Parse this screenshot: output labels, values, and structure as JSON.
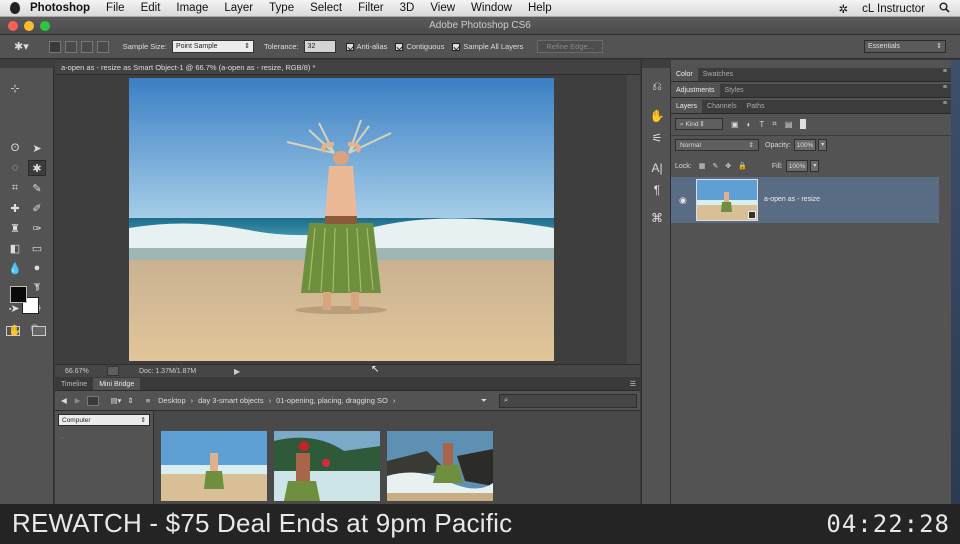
{
  "menubar": {
    "app": "Photoshop",
    "items": [
      "File",
      "Edit",
      "Image",
      "Layer",
      "Type",
      "Select",
      "Filter",
      "3D",
      "View",
      "Window",
      "Help"
    ],
    "user": "cL Instructor"
  },
  "window": {
    "title": "Adobe Photoshop CS6"
  },
  "options_bar": {
    "sample_size_label": "Sample Size:",
    "sample_size_value": "Point Sample",
    "tolerance_label": "Tolerance:",
    "tolerance_value": "32",
    "anti_alias": "Anti-alias",
    "contiguous": "Contiguous",
    "sample_all_layers": "Sample All Layers",
    "refine_edge": "Refine Edge...",
    "workspace": "Essentials"
  },
  "document": {
    "tab_title": "a-open as - resize as Smart Object-1 @ 66.7% (a-open as - resize, RGB/8) *",
    "zoom": "66.67%",
    "doc_info": "Doc: 1.37M/1.87M"
  },
  "bridge": {
    "tabs": [
      "Timeline",
      "Mini Bridge"
    ],
    "breadcrumb": [
      "Desktop",
      "day 3-smart objects",
      "01-opening, placing, dragging SO"
    ],
    "location": "Computer"
  },
  "panels": {
    "group1_tabs": [
      "Color",
      "Swatches"
    ],
    "group2_tabs": [
      "Adjustments",
      "Styles"
    ],
    "group3_tabs": [
      "Layers",
      "Channels",
      "Paths"
    ],
    "kind_filter": "Kind",
    "blend_mode": "Normal",
    "opacity_label": "Opacity:",
    "opacity_value": "100%",
    "lock_label": "Lock:",
    "fill_label": "Fill:",
    "fill_value": "100%",
    "layer_name": "a-open as - resize"
  },
  "banner": {
    "text": "REWATCH - $75 Deal Ends at 9pm Pacific",
    "timer": "04:22:28"
  }
}
